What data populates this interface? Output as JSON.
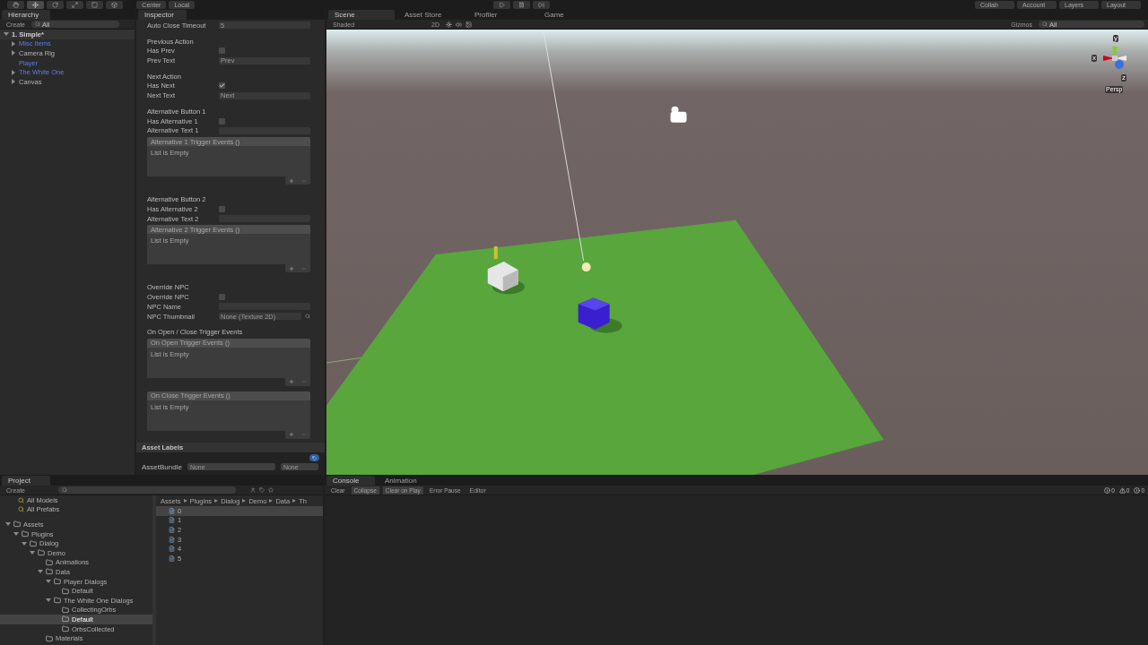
{
  "toolbar": {
    "pivot": [
      {
        "label": "Center"
      },
      {
        "label": "Local"
      }
    ],
    "right": [
      "Collab",
      "Account",
      "Layers",
      "Layout"
    ]
  },
  "hierarchy": {
    "title": "Hierarchy",
    "create": "Create",
    "search": "All",
    "scene": "1. Simple*",
    "items": [
      {
        "label": "Misc Items",
        "prefab": true,
        "expanded": false
      },
      {
        "label": "Camera Rig",
        "prefab": false,
        "expanded": false
      },
      {
        "label": "Player",
        "prefab": true
      },
      {
        "label": "The White One",
        "prefab": true,
        "expanded": false
      },
      {
        "label": "Canvas",
        "prefab": false,
        "expanded": false
      }
    ]
  },
  "inspector": {
    "title": "Inspector",
    "rows": [
      {
        "kind": "field",
        "label": "Auto Close Timeout",
        "value": "5"
      },
      {
        "kind": "header",
        "label": "Previous Action"
      },
      {
        "kind": "checkbox",
        "label": "Has Prev",
        "checked": false
      },
      {
        "kind": "field",
        "label": "Prev Text",
        "value": "Prev"
      },
      {
        "kind": "header",
        "label": "Next Action"
      },
      {
        "kind": "checkbox",
        "label": "Has Next",
        "checked": true
      },
      {
        "kind": "field",
        "label": "Next Text",
        "value": "Next"
      },
      {
        "kind": "header",
        "label": "Alternative Button 1"
      },
      {
        "kind": "checkbox",
        "label": "Has Alternative 1",
        "checked": false
      },
      {
        "kind": "field",
        "label": "Alternative Text 1"
      },
      {
        "kind": "events",
        "title": "Alternative 1 Trigger Events ()",
        "empty": "List is Empty"
      },
      {
        "kind": "header",
        "label": "Alternative Button 2"
      },
      {
        "kind": "checkbox",
        "label": "Has Alternative 2",
        "checked": false
      },
      {
        "kind": "field",
        "label": "Alternative Text 2"
      },
      {
        "kind": "events",
        "title": "Alternative 2 Trigger Events ()",
        "empty": "List is Empty"
      },
      {
        "kind": "header",
        "label": "Override NPC"
      },
      {
        "kind": "checkbox",
        "label": "Override NPC",
        "checked": false
      },
      {
        "kind": "field",
        "label": "NPC Name"
      },
      {
        "kind": "object",
        "label": "NPC Thumbnail",
        "value": "None (Texture 2D)"
      },
      {
        "kind": "header",
        "label": "On Open / Close Trigger Events"
      },
      {
        "kind": "events",
        "title": "On Open Trigger Events ()",
        "empty": "List is Empty"
      },
      {
        "kind": "events",
        "title": "On Close Trigger Events ()",
        "empty": "List is Empty"
      }
    ],
    "asset_labels": "Asset Labels",
    "bundle_label": "AssetBundle",
    "bundle_values": [
      "None",
      "None"
    ]
  },
  "scene": {
    "tabs": [
      {
        "label": "Scene",
        "selected": true
      },
      {
        "label": "Asset Store",
        "selected": false
      },
      {
        "label": "Profiler",
        "selected": false
      },
      {
        "label": "Game",
        "selected": false
      }
    ],
    "shading": "Shaded",
    "mode": "2D",
    "gizmos": "Gizmos",
    "search": "All",
    "axes": [
      "y",
      "x",
      "z"
    ],
    "projection": "Persp"
  },
  "project": {
    "title": "Project",
    "create": "Create",
    "favorites": [
      "All Models",
      "All Prefabs"
    ],
    "tree": [
      {
        "label": "Assets",
        "expanded": true,
        "selected": false,
        "children": [
          {
            "label": "Plugins",
            "expanded": true,
            "selected": false,
            "children": [
              {
                "label": "Dialog",
                "expanded": true,
                "selected": false,
                "children": [
                  {
                    "label": "Demo",
                    "expanded": true,
                    "selected": false,
                    "children": [
                      {
                        "label": "Animations",
                        "selected": false
                      },
                      {
                        "label": "Data",
                        "expanded": true,
                        "selected": false,
                        "children": [
                          {
                            "label": "Player Dialogs",
                            "expanded": true,
                            "selected": false,
                            "children": [
                              {
                                "label": "Default",
                                "selected": false
                              }
                            ]
                          },
                          {
                            "label": "The White One Dialogs",
                            "expanded": true,
                            "selected": false,
                            "children": [
                              {
                                "label": "CollectingOrbs",
                                "selected": false
                              },
                              {
                                "label": "Default",
                                "selected": true
                              },
                              {
                                "label": "OrbsCollected",
                                "selected": false
                              }
                            ]
                          }
                        ]
                      },
                      {
                        "label": "Materials",
                        "selected": false
                      }
                    ]
                  }
                ]
              }
            ]
          }
        ]
      }
    ],
    "breadcrumb": [
      "Assets",
      "Plugins",
      "Dialog",
      "Demo",
      "Data",
      "Th"
    ],
    "files": [
      {
        "label": "0",
        "selected": true
      },
      {
        "label": "1",
        "selected": false
      },
      {
        "label": "2",
        "selected": false
      },
      {
        "label": "3",
        "selected": false
      },
      {
        "label": "4",
        "selected": false
      },
      {
        "label": "5",
        "selected": false
      }
    ]
  },
  "console": {
    "tabs": [
      {
        "label": "Console",
        "selected": true
      },
      {
        "label": "Animation",
        "selected": false
      }
    ],
    "buttons": [
      {
        "label": "Clear",
        "on": false
      },
      {
        "label": "Collapse",
        "on": true
      },
      {
        "label": "Clear on Play",
        "on": true
      },
      {
        "label": "Error Pause",
        "on": false
      }
    ],
    "editor": "Editor",
    "counts": [
      "0",
      "0",
      "0"
    ]
  }
}
